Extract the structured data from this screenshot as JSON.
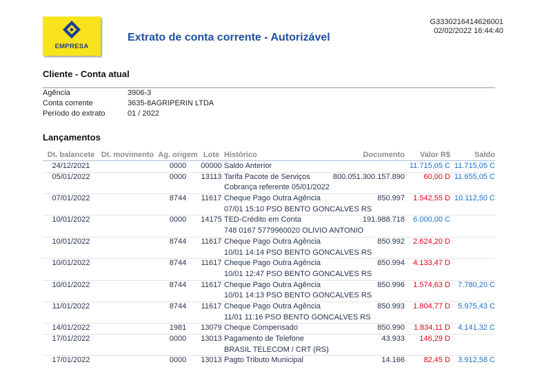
{
  "header": {
    "logo": {
      "label": "EMPRESA",
      "icon": "bb-logo-icon"
    },
    "title": "Extrato de conta corrente - Autorizável",
    "document_code": "G3330216414626001",
    "generated_at": "02/02/2022 16:44:40"
  },
  "client": {
    "heading": "Cliente - Conta atual",
    "fields": [
      {
        "label": "Agência",
        "value": "3906-3"
      },
      {
        "label": "Conta corrente",
        "value": "3635-8AGRIPERIN LTDA"
      },
      {
        "label": "Período do extrato",
        "value": "01 / 2022"
      }
    ]
  },
  "entries": {
    "heading": "Lançamentos",
    "columns": {
      "dt_balancete": "Dt. balancete",
      "dt_movimento": "Dt. movimento",
      "ag_origem": "Ag. origem",
      "lote": "Lote",
      "historico": "Histórico",
      "documento": "Documento",
      "valor": "Valor R$",
      "saldo": "Saldo"
    },
    "rows": [
      {
        "dt_balancete": "24/12/2021",
        "ag_origem": "0000",
        "lote": "00000",
        "historico": "Saldo Anterior",
        "valor": "11.715,05 C",
        "saldo": "11.715,05 C"
      },
      {
        "dt_balancete": "05/01/2022",
        "ag_origem": "0000",
        "lote": "13113",
        "historico": "Tarifa Pacote de Serviços",
        "documento": "800.051.300.157.890",
        "valor": "60,00 D",
        "saldo": "11.655,05 C",
        "detail": "Cobrança referente 05/01/2022"
      },
      {
        "dt_balancete": "07/01/2022",
        "ag_origem": "8744",
        "lote": "11617",
        "historico": "Cheque Pago Outra Agência",
        "documento": "850.997",
        "valor": "1.542,55 D",
        "saldo": "10.112,50 C",
        "detail": "07/01 15:10 PSO BENTO GONCALVES RS"
      },
      {
        "dt_balancete": "10/01/2022",
        "ag_origem": "0000",
        "lote": "14175",
        "historico": "TED-Crédito em Conta",
        "documento": "191.988.718",
        "valor": "6.000,00 C",
        "detail": "748 0167 5779960020 OLIVIO ANTONIO"
      },
      {
        "dt_balancete": "10/01/2022",
        "ag_origem": "8744",
        "lote": "11617",
        "historico": "Cheque Pago Outra Agência",
        "documento": "850.992",
        "valor": "2.624,20 D",
        "detail": "10/01 14:14 PSO BENTO GONCALVES RS"
      },
      {
        "dt_balancete": "10/01/2022",
        "ag_origem": "8744",
        "lote": "11617",
        "historico": "Cheque Pago Outra Agência",
        "documento": "850.994",
        "valor": "4.133,47 D",
        "detail": "10/01 12:47 PSO BENTO GONCALVES RS"
      },
      {
        "dt_balancete": "10/01/2022",
        "ag_origem": "8744",
        "lote": "11617",
        "historico": "Cheque Pago Outra Agência",
        "documento": "850.996",
        "valor": "1.574,63 D",
        "saldo": "7.780,20 C",
        "detail": "10/01 14:13 PSO BENTO GONCALVES RS"
      },
      {
        "dt_balancete": "11/01/2022",
        "ag_origem": "8744",
        "lote": "11617",
        "historico": "Cheque Pago Outra Agência",
        "documento": "850.993",
        "valor": "1.804,77 D",
        "saldo": "5.975,43 C",
        "detail": "11/01 11:16 PSO BENTO GONCALVES RS"
      },
      {
        "dt_balancete": "14/01/2022",
        "ag_origem": "1981",
        "lote": "13079",
        "historico": "Cheque Compensado",
        "documento": "850.990",
        "valor": "1.834,11 D",
        "saldo": "4.141,32 C"
      },
      {
        "dt_balancete": "17/01/2022",
        "ag_origem": "0000",
        "lote": "13013",
        "historico": "Pagamento de Telefone",
        "documento": "43.933",
        "valor": "146,29 D",
        "detail": "BRASIL TELECOM / CRT (RS)"
      },
      {
        "dt_balancete": "17/01/2022",
        "ag_origem": "0000",
        "lote": "13013",
        "historico": "Pagto Tributo Municipal",
        "documento": "14.166",
        "valor": "82,45 D",
        "saldo": "3.912,58 C"
      }
    ]
  },
  "colors": {
    "brand_yellow": "#f9e31c",
    "brand_blue": "#1b3f93",
    "title": "#1f4f9e",
    "credit": "#1a6fc4",
    "debit": "#e3001b",
    "header_text": "#8c8c8c"
  }
}
